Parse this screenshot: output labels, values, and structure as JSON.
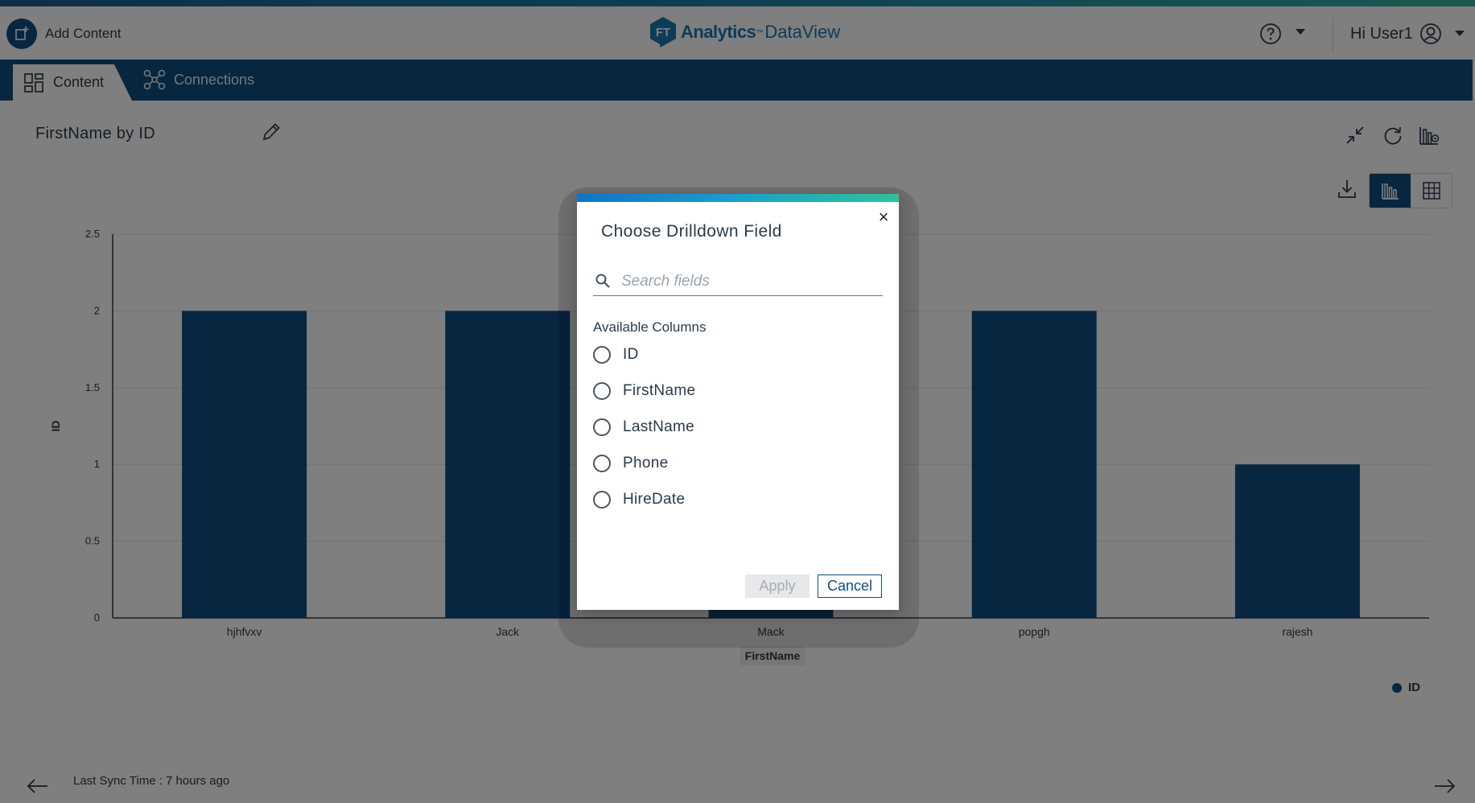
{
  "header": {
    "add_content_label": "Add Content",
    "logo_brand": "FT",
    "logo_name": "Analytics",
    "logo_tm": "™",
    "logo_product": "DataView",
    "user_greeting": "Hi User1"
  },
  "tabs": [
    {
      "label": "Content",
      "active": true,
      "icon": "dashboard-grid-icon"
    },
    {
      "label": "Connections",
      "active": false,
      "icon": "connections-network-icon"
    }
  ],
  "widget": {
    "title": "FirstName by ID",
    "toolbar_icons": [
      "collapse-icon",
      "refresh-icon",
      "chart-settings-icon",
      "download-icon",
      "bar-chart-view-icon",
      "table-view-icon"
    ],
    "active_view": "chart"
  },
  "chart_data": {
    "type": "bar",
    "categories": [
      "hjhfvxv",
      "Jack",
      "Mack",
      "popgh",
      "rajesh"
    ],
    "series": [
      {
        "name": "ID",
        "values": [
          2,
          2,
          2,
          2,
          1
        ]
      }
    ],
    "xlabel": "FirstName",
    "ylabel": "ID",
    "yticks": [
      "0",
      "0.5",
      "1",
      "1.5",
      "2",
      "2.5"
    ],
    "ylim": [
      0,
      2.5
    ],
    "grid": true,
    "legend": "bottom-right",
    "color": "#0f4c81"
  },
  "footer": {
    "sync_text": "Last Sync Time : 7 hours ago"
  },
  "modal": {
    "title": "Choose Drilldown Field",
    "close_symbol": "×",
    "search_placeholder": "Search fields",
    "search_value": "",
    "section_label": "Available Columns",
    "options": [
      "ID",
      "FirstName",
      "LastName",
      "Phone",
      "HireDate"
    ],
    "apply_label": "Apply",
    "cancel_label": "Cancel"
  }
}
